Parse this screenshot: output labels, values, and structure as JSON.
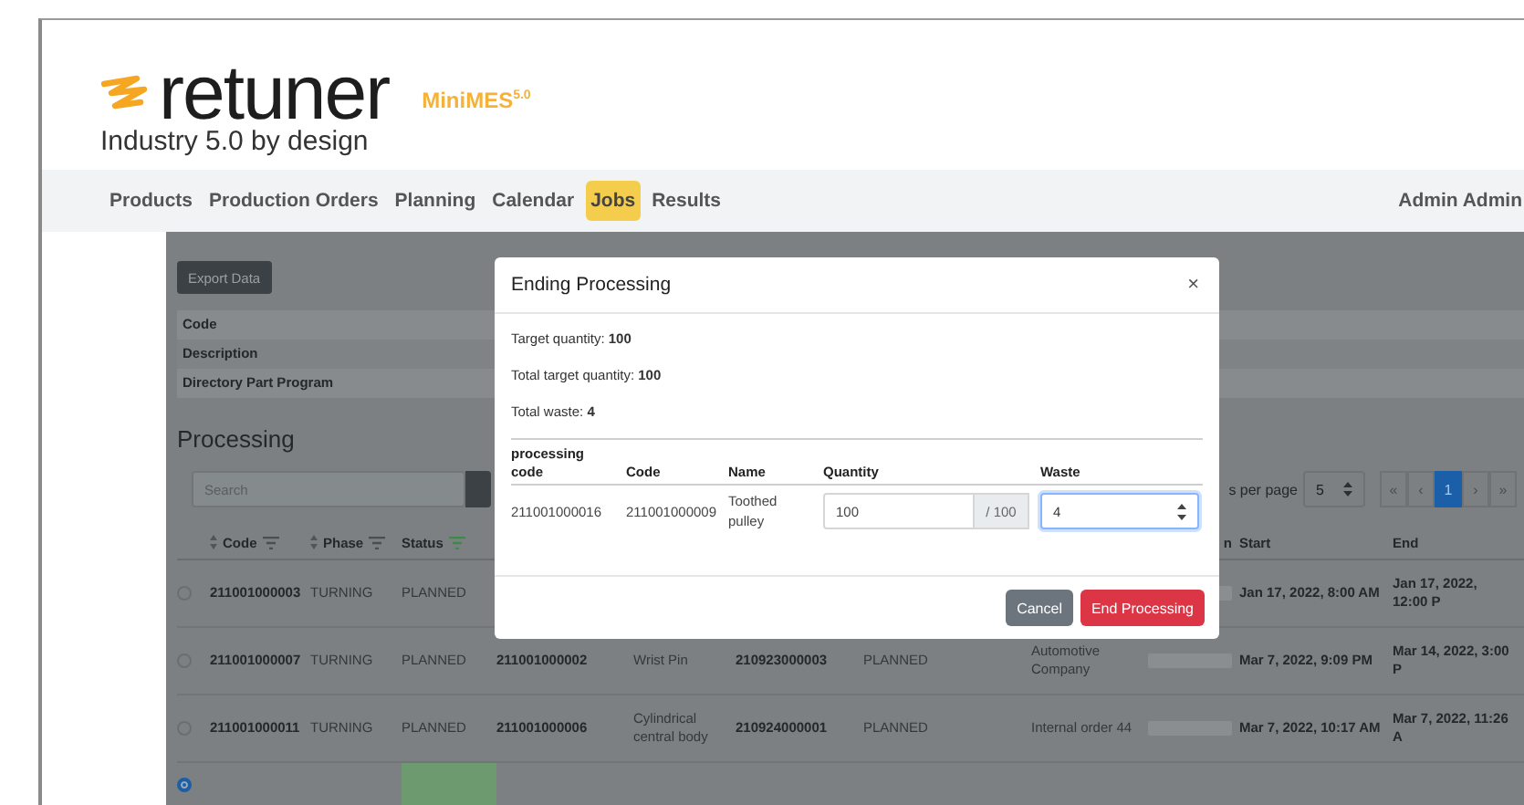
{
  "logo": {
    "wordmark": "retuner",
    "product": "MiniMES",
    "version": "5.0",
    "tagline": "Industry 5.0 by design"
  },
  "nav": {
    "items": [
      {
        "label": "Products",
        "selected": false
      },
      {
        "label": "Production Orders",
        "selected": false
      },
      {
        "label": "Planning",
        "selected": false
      },
      {
        "label": "Calendar",
        "selected": false
      },
      {
        "label": "Jobs",
        "selected": true
      },
      {
        "label": "Results",
        "selected": false
      }
    ],
    "user": "Admin Admin"
  },
  "page": {
    "export_button": "Export Data",
    "details": [
      "Code",
      "Description",
      "Directory Part Program"
    ],
    "section_title": "Processing",
    "search": {
      "placeholder": "Search"
    },
    "per_page": {
      "label": "s per page",
      "value": "5"
    },
    "pagination": [
      {
        "label": "«",
        "selected": false
      },
      {
        "label": "‹",
        "selected": false
      },
      {
        "label": "1",
        "selected": true
      },
      {
        "label": "›",
        "selected": false
      },
      {
        "label": "»",
        "selected": false
      }
    ],
    "table": {
      "columns": [
        {
          "label": "Code",
          "sortable": true,
          "filter_active": false
        },
        {
          "label": "Phase",
          "sortable": true,
          "filter_active": false
        },
        {
          "label": "Status",
          "sortable": false,
          "filter_active": true
        },
        {
          "label": "n"
        },
        {
          "label": "Start"
        },
        {
          "label": "End"
        }
      ],
      "rows": [
        {
          "selected": false,
          "highlighted": false,
          "code": "211001000003",
          "phase": "TURNING",
          "status": "PLANNED",
          "level": 0,
          "start": "Jan 17, 2022, 8:00 AM",
          "end": "Jan 17, 2022, 12:00 P"
        },
        {
          "selected": false,
          "highlighted": false,
          "code": "211001000007",
          "phase": "TURNING",
          "status": "PLANNED",
          "order_code": "211001000002",
          "name": "Wrist Pin",
          "part_code": "210923000003",
          "order_status": "PLANNED",
          "customer": "Automotive Company",
          "level": 0,
          "start": "Mar 7, 2022, 9:09 PM",
          "end": "Mar 14, 2022, 3:00 P"
        },
        {
          "selected": false,
          "highlighted": false,
          "code": "211001000011",
          "phase": "TURNING",
          "status": "PLANNED",
          "order_code": "211001000006",
          "name": "Cylindrical central body",
          "part_code": "210924000001",
          "order_status": "PLANNED",
          "customer": "Internal order 44",
          "level": 0,
          "start": "Mar 7, 2022, 10:17 AM",
          "end": "Mar 7, 2022, 11:26 A"
        },
        {
          "selected": true,
          "highlighted": true
        }
      ]
    }
  },
  "dialog": {
    "title": "Ending Processing",
    "close": "×",
    "summary": [
      {
        "label": "Target quantity:",
        "value": "100"
      },
      {
        "label": "Total target quantity:",
        "value": "100"
      },
      {
        "label": "Total waste:",
        "value": "4"
      }
    ],
    "columns": [
      "processing code",
      "Code",
      "Name",
      "Quantity",
      "Waste"
    ],
    "rows": [
      {
        "processing_code": "211001000016",
        "code": "211001000009",
        "name": "Toothed pulley",
        "quantity": "100",
        "max_quantity": "/ 100",
        "waste": "4",
        "waste_focused": true
      }
    ],
    "buttons": [
      {
        "label": "Cancel",
        "kind": "secondary"
      },
      {
        "label": "End Processing",
        "kind": "danger"
      }
    ]
  }
}
